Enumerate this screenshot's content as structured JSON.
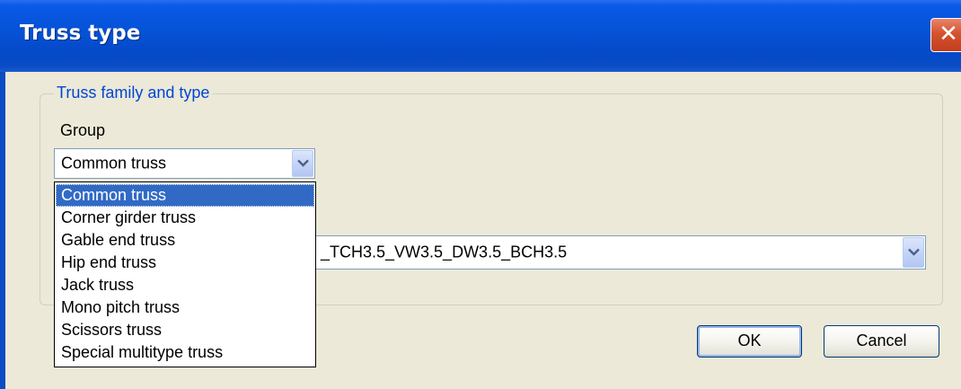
{
  "window": {
    "title": "Truss type",
    "close_symbol": "✕"
  },
  "group_box": {
    "legend": "Truss family and type"
  },
  "group_field": {
    "label": "Group",
    "value": "Common truss"
  },
  "dropdown": {
    "options": [
      "Common truss",
      "Corner girder truss",
      "Gable end truss",
      "Hip end truss",
      "Jack truss",
      "Mono pitch truss",
      "Scissors truss",
      "Special multitype truss"
    ],
    "selected": "Common truss"
  },
  "type_field": {
    "value": "_TCH3.5_VW3.5_DW3.5_BCH3.5"
  },
  "buttons": {
    "ok": "OK",
    "cancel": "Cancel"
  },
  "icons": {
    "combo_arrow": "chevron-down-icon",
    "close": "close-icon"
  },
  "colors": {
    "title_bar": "#0a4cc4",
    "legend_text": "#0046d5",
    "selection": "#316ac5",
    "close_button": "#d4532e"
  }
}
